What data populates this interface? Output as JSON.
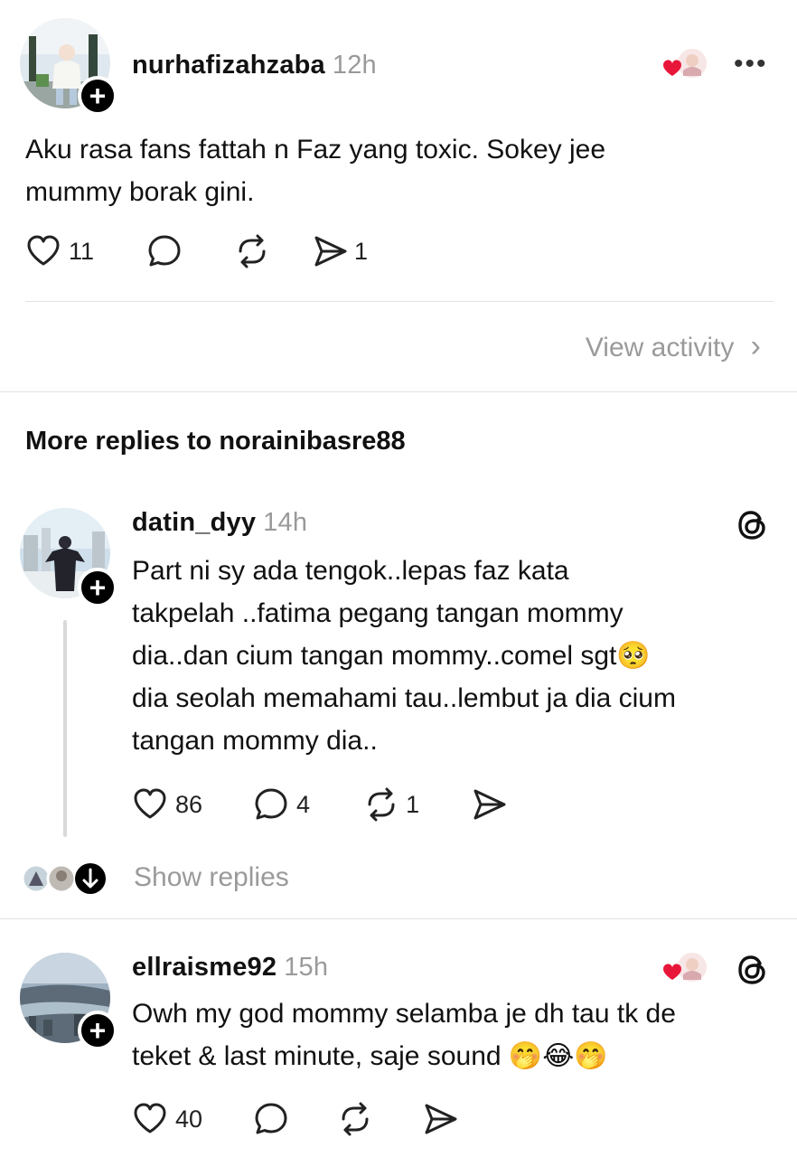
{
  "post1": {
    "username": "nurhafizahzaba",
    "time": "12h",
    "text_line1": "Aku rasa fans fattah n Faz yang toxic. Sokey jee",
    "text_line2": "mummy borak gini.",
    "likes": "11",
    "reposts": "",
    "shares": "1",
    "more_label": "•••"
  },
  "view_activity": {
    "label": "View activity",
    "chevron": "›"
  },
  "section_title": "More replies to norainibasre88",
  "post2": {
    "username": "datin_dyy",
    "time": "14h",
    "text_line1": "Part ni sy ada tengok..lepas faz kata",
    "text_line2": "takpelah ..fatima pegang tangan mommy",
    "text_line3": "dia..dan cium tangan mommy..comel sgt🥺",
    "text_line4": "dia seolah memahami tau..lembut ja dia cium",
    "text_line5": "tangan mommy dia..",
    "likes": "86",
    "replies": "4",
    "reposts": "1",
    "show_replies": "Show replies"
  },
  "post3": {
    "username": "ellraisme92",
    "time": "15h",
    "text_line1": "Owh my god mommy selamba je dh tau tk de",
    "text_line2": "teket & last minute,  saje sound 🤭😂🤭",
    "likes": "40"
  },
  "colors": {
    "heart_red": "#e8173a",
    "muted": "#9a9a9a",
    "text": "#111111"
  },
  "icons": {
    "like": "heart-outline-icon",
    "reply": "speech-bubble-icon",
    "repost": "repost-arrows-icon",
    "share": "paper-plane-icon",
    "threads": "threads-logo-icon"
  }
}
